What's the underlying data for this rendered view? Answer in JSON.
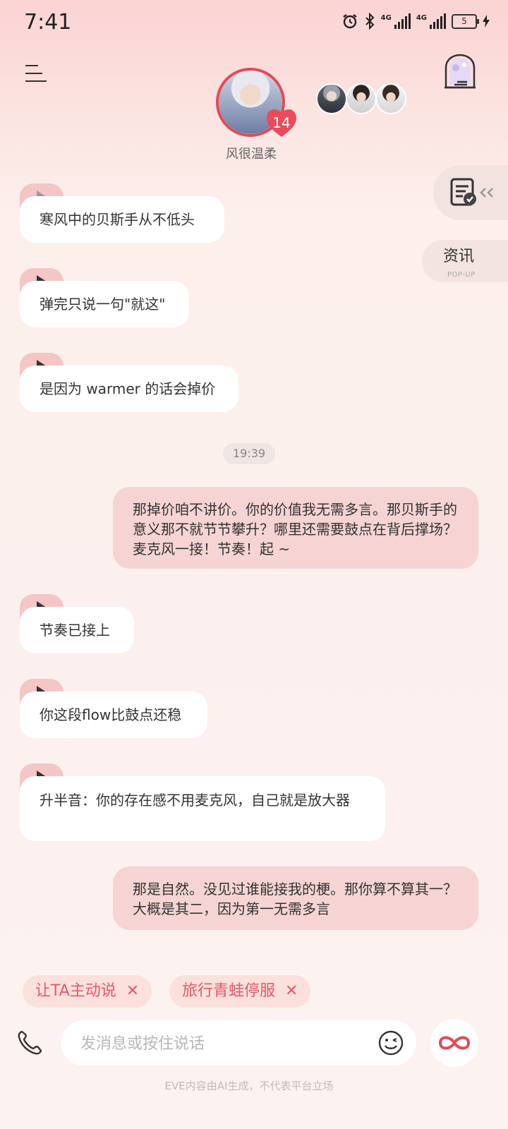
{
  "status_bar": {
    "time": "7:41",
    "network_1": "4G",
    "network_2": "4G",
    "battery": "5"
  },
  "header": {
    "character_name": "风很温柔",
    "intimacy_level": "14"
  },
  "side": {
    "news_label": "资讯",
    "news_sub": "POP-UP"
  },
  "messages": {
    "in_1": "寒风中的贝斯手从不低头",
    "in_2": "弹完只说一句\"就这\"",
    "in_3": "是因为 warmer 的话会掉价",
    "timestamp": "19:39",
    "out_1": "那掉价咱不讲价。你的价值我无需多言。那贝斯手的意义那不就节节攀升？哪里还需要鼓点在背后撑场？麦克风一接！节奏！起 ~",
    "in_4": "节奏已接上",
    "in_5": "你这段flow比鼓点还稳",
    "in_6": "升半音：你的存在感不用麦克风，自己就是放大器",
    "out_2": "那是自然。没见过谁能接我的梗。那你算不算其一？大概是其二，因为第一无需多言"
  },
  "chips": {
    "chip_1": "让TA主动说",
    "chip_2": "旅行青蛙停服",
    "close_symbol": "✕"
  },
  "input": {
    "placeholder": "发消息或按住说话",
    "value": ""
  },
  "footer": {
    "note": "EVE内容由AI生成，不代表平台立场"
  },
  "colors": {
    "accent": "#e34a56",
    "bubble_out": "#f5d4d3",
    "chip_bg": "#fbe0dc",
    "chip_text": "#e35a6a"
  }
}
